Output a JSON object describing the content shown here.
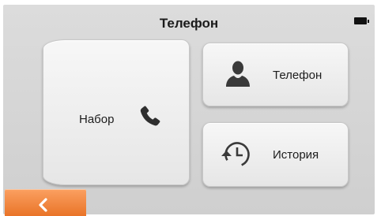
{
  "header": {
    "title": "Телефон",
    "battery_icon": "battery-full-icon"
  },
  "tiles": {
    "dial": {
      "label": "Набор",
      "icon": "phone-handset-icon"
    },
    "phone": {
      "label": "Телефон",
      "icon": "person-icon"
    },
    "history": {
      "label": "История",
      "icon": "history-clock-icon"
    }
  },
  "footer": {
    "back_icon": "chevron-left-icon"
  },
  "colors": {
    "background": "#d6d6d6",
    "tile": "#efefef",
    "back_button": "#f28a43",
    "text": "#1d1d1d"
  }
}
